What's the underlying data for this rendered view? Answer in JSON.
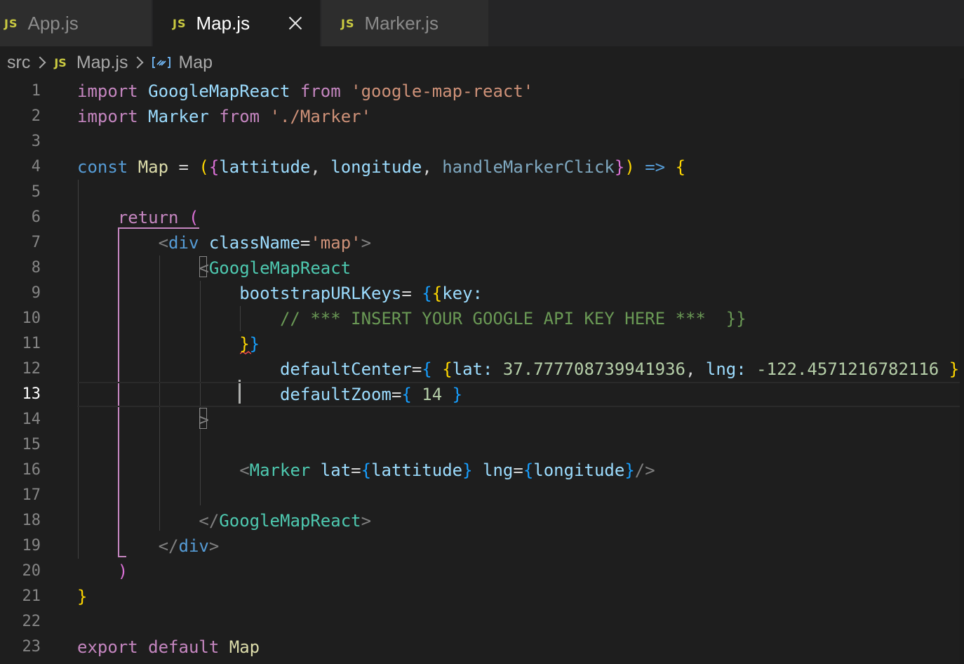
{
  "tabs": [
    {
      "label": "App.js",
      "icon": "JS",
      "active": false
    },
    {
      "label": "Map.js",
      "icon": "JS",
      "active": true
    },
    {
      "label": "Marker.js",
      "icon": "JS",
      "active": false
    }
  ],
  "breadcrumb": {
    "folder": "src",
    "file": "Map.js",
    "file_icon": "JS",
    "symbol": "Map"
  },
  "editor": {
    "current_line": 13,
    "line_numbers": [
      "1",
      "2",
      "3",
      "4",
      "5",
      "6",
      "7",
      "8",
      "9",
      "10",
      "11",
      "12",
      "13",
      "14",
      "15",
      "16",
      "17",
      "18",
      "19",
      "20",
      "21",
      "22",
      "23"
    ],
    "tokens": {
      "import": "import",
      "from": "from",
      "GoogleMapReact": "GoogleMapReact",
      "google_map_react_str": "'google-map-react'",
      "Marker": "Marker",
      "marker_path_str": "'./Marker'",
      "const": "const",
      "Map": "Map",
      "eq": " = ",
      "open_paren": "(",
      "open_brace": "{",
      "lattitude": "lattitude",
      "comma": ", ",
      "longitude": "longitude",
      "handleMarkerClick": "handleMarkerClick",
      "close_brace": "}",
      "close_paren": ")",
      "arrow": "=>",
      "return": "return",
      "lt": "<",
      "gt": ">",
      "div": "div",
      "className": "className",
      "eq_sign": "=",
      "map_str": "'map'",
      "bootstrapURLKeys": "bootstrapURLKeys",
      "key": "key",
      "colon": ":",
      "comment": "// *** INSERT YOUR GOOGLE API KEY HERE ***",
      "defaultCenter": "defaultCenter",
      "lat": "lat",
      "lat_value": "37.777708739941936",
      "lng": "lng",
      "lng_value": "-122.4571216782116",
      "defaultZoom": "defaultZoom",
      "zoom_value": "14",
      "self_close": "/>",
      "close_tag_open": "</",
      "export": "export",
      "default": "default"
    }
  },
  "colors": {
    "background": "#1e1e1e",
    "tabbar": "#252526",
    "js_icon": "#cbcb41",
    "keyword": "#c586c0",
    "storage": "#569cd6",
    "string": "#ce9178",
    "comment": "#6a9955",
    "number": "#b5cea8",
    "jsx_component": "#4ec9b0",
    "variable": "#9cdcfe",
    "bracket_gold": "#ffd700",
    "bracket_orchid": "#da70d6",
    "bracket_blue": "#179fff"
  }
}
